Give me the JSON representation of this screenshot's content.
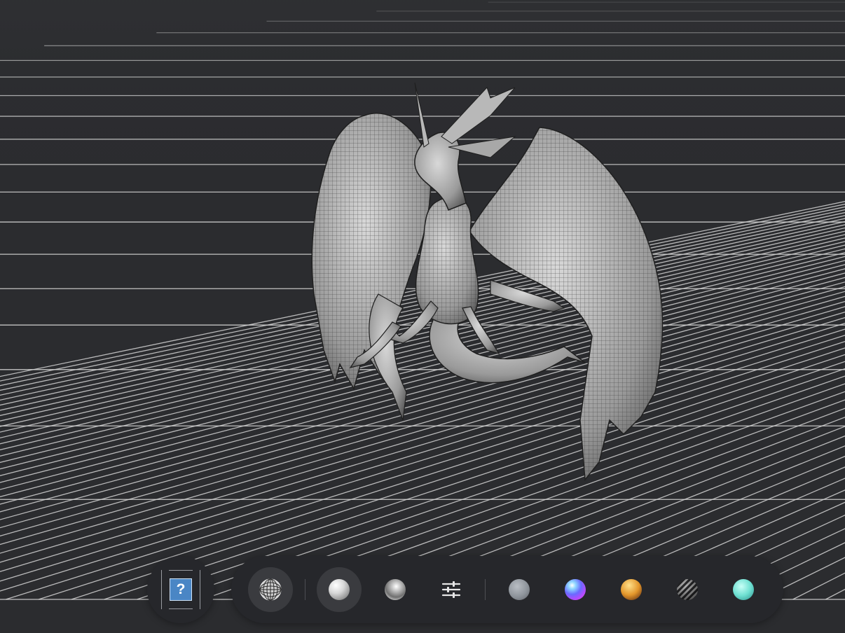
{
  "app": {
    "viewport": "3d-model-viewport",
    "model": "dragon-wireframe"
  },
  "toolbar": {
    "help": {
      "label": "?",
      "icon": "help-icon"
    },
    "wireframe_toggle": {
      "icon": "wireframe-globe-icon",
      "active": true
    },
    "matcap_white": {
      "icon": "white-clay-sphere-icon",
      "active": true
    },
    "matcap_chrome": {
      "icon": "chrome-sphere-icon",
      "active": false
    },
    "settings": {
      "icon": "sliders-icon"
    },
    "materials": [
      {
        "icon": "gray-matcap-icon",
        "color": "#8e949b"
      },
      {
        "icon": "iridescent-matcap-icon",
        "color": "#8b5cff"
      },
      {
        "icon": "orange-matcap-icon",
        "color": "#e3962b"
      },
      {
        "icon": "striped-metal-matcap-icon",
        "color": "#7c7d80"
      },
      {
        "icon": "cyan-matcap-icon",
        "color": "#6fe0d2"
      }
    ]
  },
  "colors": {
    "background": "#2b2c2f",
    "grid": "#d9d9d9",
    "dock": "#26272b",
    "accent": "#4a86c5"
  }
}
